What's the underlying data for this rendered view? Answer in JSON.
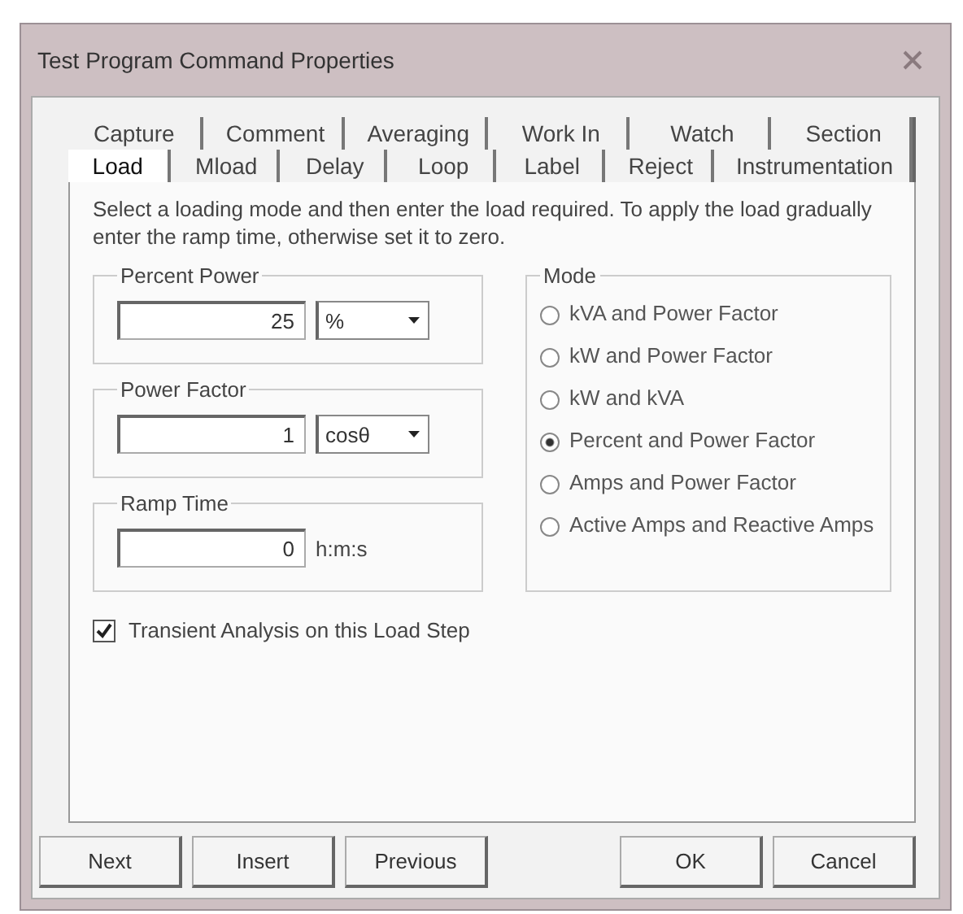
{
  "window": {
    "title": "Test Program Command Properties"
  },
  "tab_rows": [
    [
      {
        "label": "Capture",
        "selected": false
      },
      {
        "label": "Comment",
        "selected": false
      },
      {
        "label": "Averaging",
        "selected": false
      },
      {
        "label": "Work In",
        "selected": false
      },
      {
        "label": "Watch",
        "selected": false
      },
      {
        "label": "Section",
        "selected": false
      }
    ],
    [
      {
        "label": "Load",
        "selected": true
      },
      {
        "label": "Mload",
        "selected": false
      },
      {
        "label": "Delay",
        "selected": false
      },
      {
        "label": "Loop",
        "selected": false
      },
      {
        "label": "Label",
        "selected": false
      },
      {
        "label": "Reject",
        "selected": false
      },
      {
        "label": "Instrumentation",
        "selected": false
      }
    ]
  ],
  "instructions": "Select a loading mode and then enter the load required.  To apply the load gradually enter the ramp time, otherwise set it to zero.",
  "groups": [
    {
      "title": "Percent Power",
      "value": "25",
      "kind": "dropdown",
      "unit": "%"
    },
    {
      "title": "Power Factor",
      "value": "1",
      "kind": "dropdown",
      "unit": "cosθ"
    },
    {
      "title": "Ramp Time",
      "value": "0",
      "kind": "label",
      "unit": "h:m:s"
    }
  ],
  "mode": {
    "title": "Mode",
    "options": [
      {
        "label": "kVA and Power Factor",
        "selected": false
      },
      {
        "label": "kW and Power Factor",
        "selected": false
      },
      {
        "label": "kW and kVA",
        "selected": false
      },
      {
        "label": "Percent and Power Factor",
        "selected": true
      },
      {
        "label": "Amps and Power Factor",
        "selected": false
      },
      {
        "label": "Active Amps and Reactive Amps",
        "selected": false
      }
    ]
  },
  "transient_analysis": {
    "label": "Transient Analysis on this Load Step",
    "checked": true
  },
  "buttons": [
    "Next",
    "Insert",
    "Previous",
    "OK",
    "Cancel"
  ]
}
